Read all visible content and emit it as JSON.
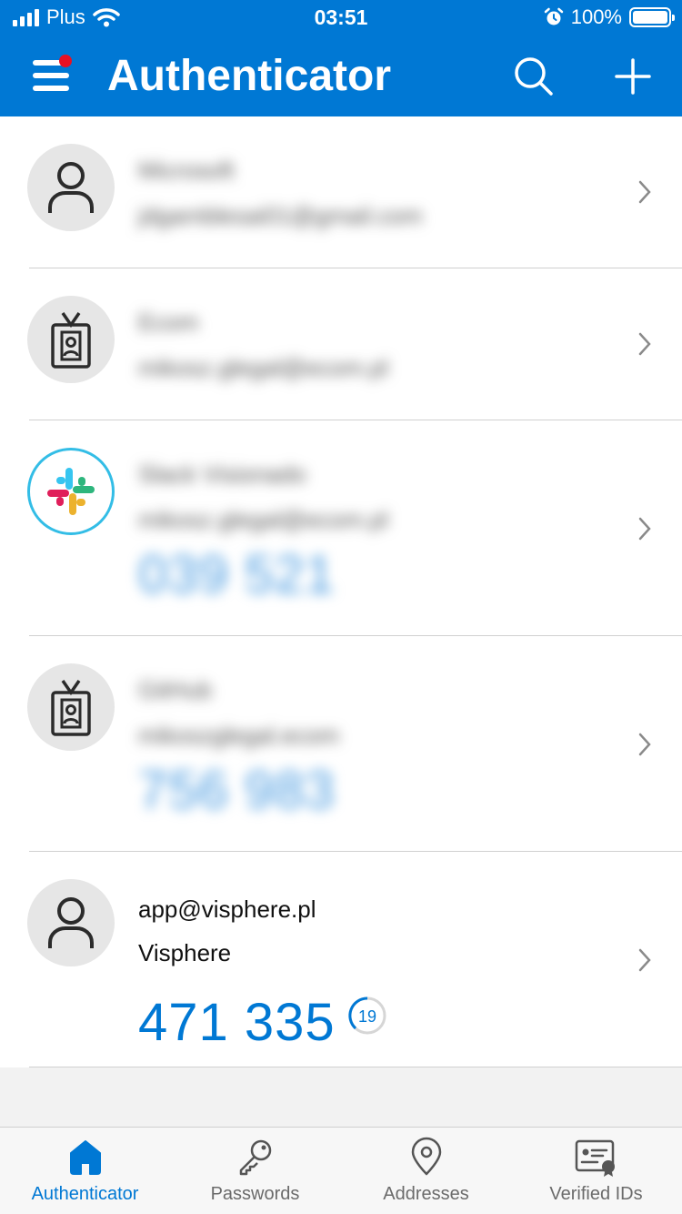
{
  "status_bar": {
    "carrier": "Plus",
    "time": "03:51",
    "battery": "100%"
  },
  "header": {
    "title": "Authenticator"
  },
  "accounts": [
    {
      "name": "Microsoft",
      "user": "jdgamblesai01@gmail.com",
      "icon": "person-icon",
      "code": ""
    },
    {
      "name": "Ecom",
      "user": "mikosz.glegal@ecom.pl",
      "icon": "badge-icon",
      "code": ""
    },
    {
      "name": "Slack Visionado",
      "user": "mikosz.glegal@ecom.pl",
      "icon": "slack-logo-icon",
      "code": "039 521"
    },
    {
      "name": "GitHub",
      "user": "mikoszglegal.ecom",
      "icon": "badge-icon",
      "code": "756 983"
    },
    {
      "name": "app@visphere.pl",
      "user": "Visphere",
      "icon": "person-icon",
      "code": "471 335",
      "timer": "19"
    }
  ],
  "tabs": [
    {
      "label": "Authenticator",
      "icon": "home-icon",
      "active": true
    },
    {
      "label": "Passwords",
      "icon": "key-icon",
      "active": false
    },
    {
      "label": "Addresses",
      "icon": "location-pin-icon",
      "active": false
    },
    {
      "label": "Verified IDs",
      "icon": "id-card-icon",
      "active": false
    }
  ],
  "colors": {
    "brand": "#0078d4",
    "notification": "#e81123"
  }
}
